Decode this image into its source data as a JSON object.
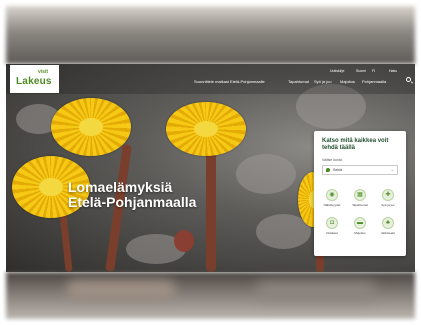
{
  "logo": {
    "small": "visit",
    "main": "Lakeus"
  },
  "utility_links": [
    "Uutiskirje",
    "Suomi",
    "FI",
    "Haku"
  ],
  "nav": [
    "Suunnittele matkasi Etelä-Pohjanmaalle",
    "Tapahtumat",
    "Syö ja juo",
    "Majoitus",
    "Pohjanmaalla"
  ],
  "hero": {
    "title": "Lomaelämyksiä Etelä-Pohjanmaalla"
  },
  "finder_card": {
    "title": "Katso mitä kaikkea voit tehdä täällä",
    "select_label": "Valitse kunta",
    "select_value": "Seinä",
    "categories": [
      {
        "label": "Nähtävyydet",
        "icon": "camera-icon",
        "glyph": "◉"
      },
      {
        "label": "Tapahtumat",
        "icon": "calendar-icon",
        "glyph": "▦"
      },
      {
        "label": "Syö ja juo",
        "icon": "cutlery-icon",
        "glyph": "✚"
      },
      {
        "label": "Ostokset",
        "icon": "bag-icon",
        "glyph": "◘"
      },
      {
        "label": "Majoitus",
        "icon": "bed-icon",
        "glyph": "▬"
      },
      {
        "label": "Aktiviteetit",
        "icon": "leaf-icon",
        "glyph": "♣"
      }
    ]
  },
  "colors": {
    "brand_green": "#4c8b24",
    "flower_yellow": "#f6c915"
  }
}
